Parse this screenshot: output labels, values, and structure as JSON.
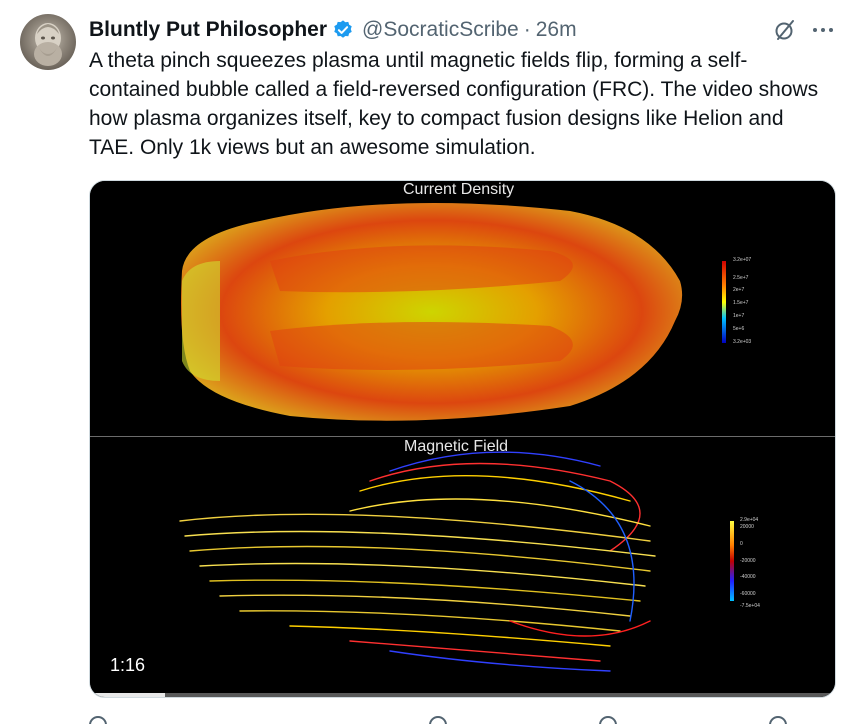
{
  "author": {
    "name": "Bluntly Put Philosopher",
    "handle": "@SocraticScribe",
    "separator": "·",
    "time": "26m"
  },
  "tweet": {
    "text": "A theta pinch squeezes plasma until magnetic fields flip, forming a self-contained bubble called a field-reversed configuration (FRC). The video shows how plasma organizes itself, key to compact fusion designs like Helion and TAE. Only 1k views but an awesome simulation."
  },
  "video": {
    "top_title": "Current Density",
    "bottom_title": "Magnetic Field",
    "duration": "1:16",
    "progress": 0.1,
    "top_legend": [
      "3.2e+07",
      "2.5e+7",
      "2e+7",
      "1.5e+7",
      "1e+7",
      "5e+6",
      "3.2e+03"
    ],
    "top_legend_axis": "curl Magnitude",
    "bottom_legend": [
      "2.9e+04",
      "20000",
      "0",
      "-20000",
      "-40000",
      "-60000",
      "-7.5e+04"
    ],
    "bottom_legend_axis": "z Bxy"
  },
  "colors": {
    "verified": "#1d9bf0",
    "text": "#0f1419",
    "muted": "#536471"
  },
  "icons": [
    "verified-badge-icon",
    "grok-icon",
    "more-icon"
  ]
}
